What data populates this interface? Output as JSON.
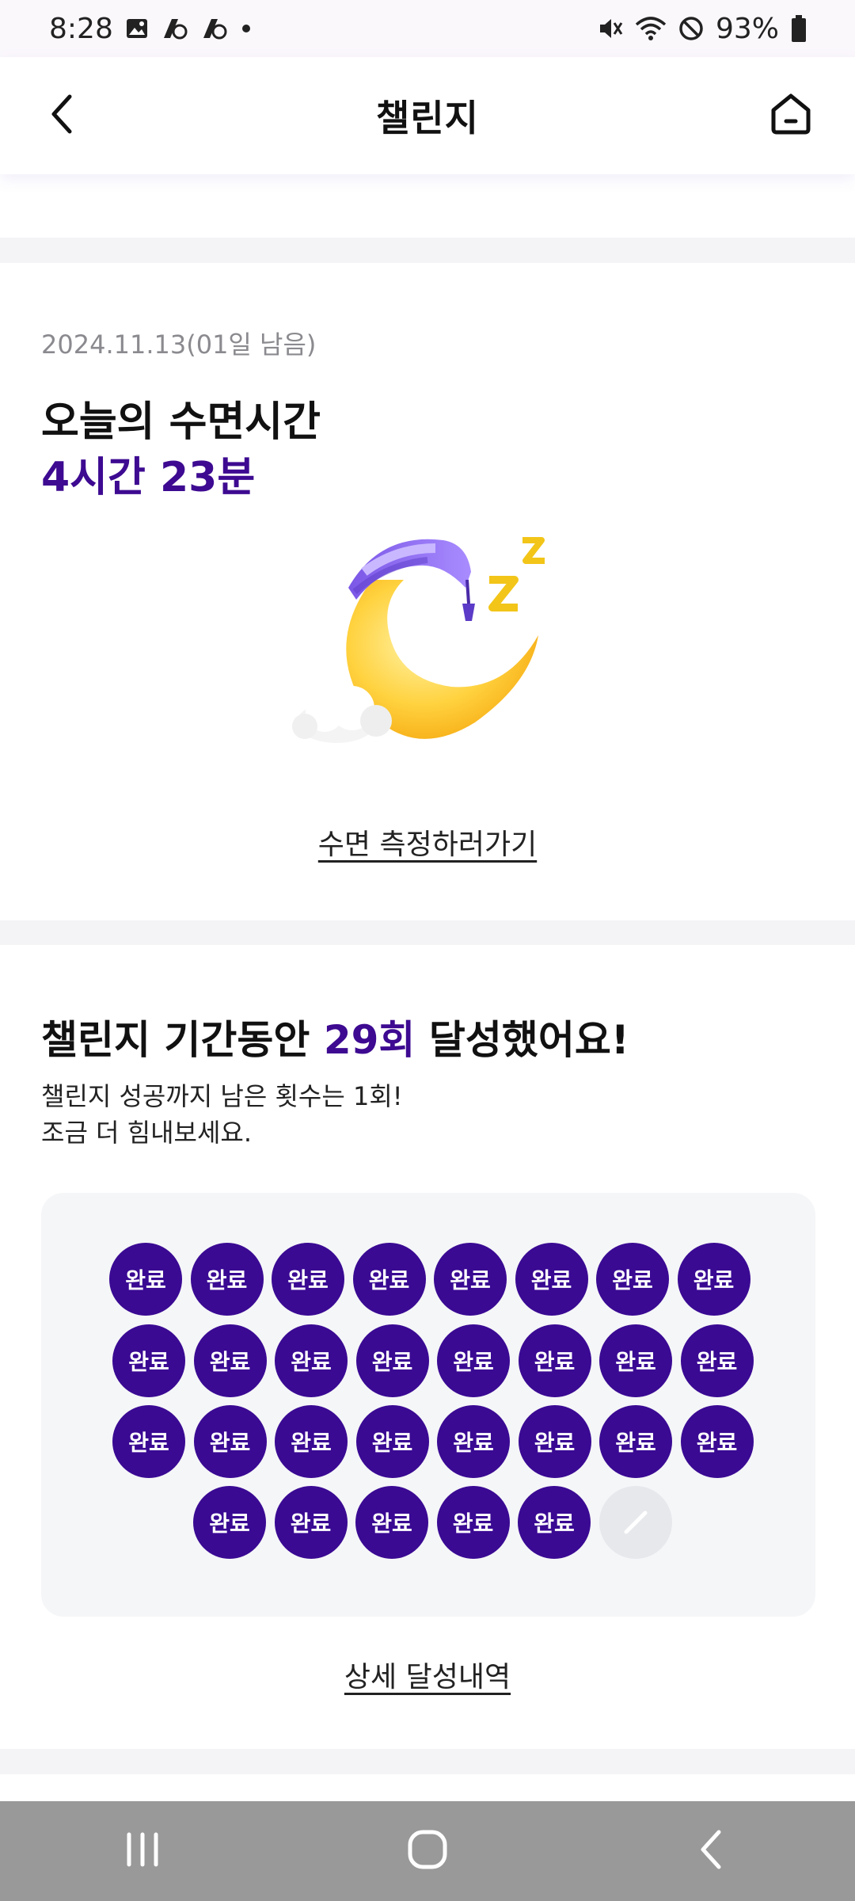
{
  "status_bar": {
    "time": "8:28",
    "battery": "93%",
    "left_icons": [
      "gallery-icon",
      "app-icon",
      "app-icon",
      "dot-icon"
    ],
    "right_icons": [
      "mute-icon",
      "wifi-icon",
      "dnd-icon",
      "battery-icon"
    ]
  },
  "header": {
    "title": "챌린지",
    "back_icon": "chevron-left-icon",
    "home_icon": "home-icon"
  },
  "sleep": {
    "date": "2024.11.13(01일 남음)",
    "title": "오늘의 수면시간",
    "value": "4시간 23분",
    "link": "수면 측정하러가기"
  },
  "challenge": {
    "title_prefix": "챌린지 기간동안 ",
    "title_count": "29회",
    "title_suffix": " 달성했어요!",
    "sub_line1": "챌린지 성공까지 남은 횟수는 1회!",
    "sub_line2": "조금 더 힘내보세요.",
    "completed": 29,
    "total": 30,
    "stamp_label": "완료",
    "link": "상세 달성내역"
  },
  "colors": {
    "accent": "#3d0a91",
    "stamp": "#3a0a93",
    "stamp_empty": "#e7e8ec",
    "panel": "#f5f6f8"
  },
  "nav": {
    "recents_icon": "recents-icon",
    "home_icon": "home-circle-icon",
    "back_icon": "back-icon"
  }
}
